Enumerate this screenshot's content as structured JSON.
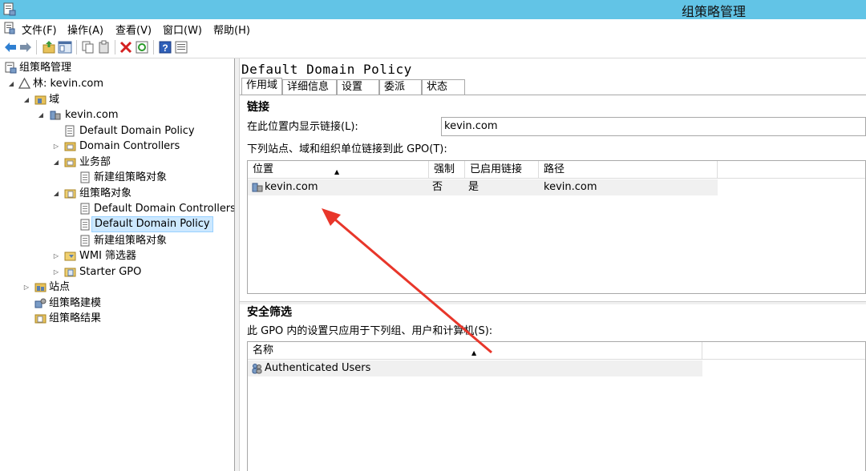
{
  "window": {
    "title": "组策略管理"
  },
  "menu": [
    "文件(F)",
    "操作(A)",
    "查看(V)",
    "窗口(W)",
    "帮助(H)"
  ],
  "toolbar": [
    "back-icon",
    "forward-icon",
    "up-folder-icon",
    "show-hide-tree-icon",
    "copy-icon",
    "paste-icon",
    "delete-icon",
    "refresh-icon",
    "help-icon",
    "properties-icon"
  ],
  "tree": {
    "root": "组策略管理",
    "forest": "林: kevin.com",
    "domains": "域",
    "domain": "kevin.com",
    "default_policy_link": "Default Domain Policy",
    "domain_controllers": "Domain Controllers",
    "ou": "业务部",
    "ou_gpo": "新建组策略对象",
    "gpo_container": "组策略对象",
    "gpo_dc": "Default Domain Controllers",
    "gpo_default": "Default Domain Policy",
    "gpo_new": "新建组策略对象",
    "wmi": "WMI 筛选器",
    "starter": "Starter GPO",
    "sites": "站点",
    "modeling": "组策略建模",
    "results": "组策略结果"
  },
  "details": {
    "title": "Default Domain Policy",
    "tabs": [
      "作用域",
      "详细信息",
      "设置",
      "委派",
      "状态"
    ],
    "links_heading": "链接",
    "location_label": "在此位置内显示链接(L):",
    "location_value": "kevin.com",
    "links_desc": "下列站点、域和组织单位链接到此 GPO(T):",
    "links_columns": [
      "位置",
      "强制",
      "已启用链接",
      "路径"
    ],
    "links_rows": [
      {
        "location": "kevin.com",
        "enforced": "否",
        "enabled": "是",
        "path": "kevin.com"
      }
    ],
    "security_heading": "安全筛选",
    "security_desc": "此 GPO 内的设置只应用于下列组、用户和计算机(S):",
    "security_columns": [
      "名称"
    ],
    "security_rows": [
      "Authenticated Users"
    ]
  },
  "colors": {
    "titlebar": "#62c4e6",
    "selection": "#cce8ff",
    "annotation_arrow": "#e8362a"
  }
}
